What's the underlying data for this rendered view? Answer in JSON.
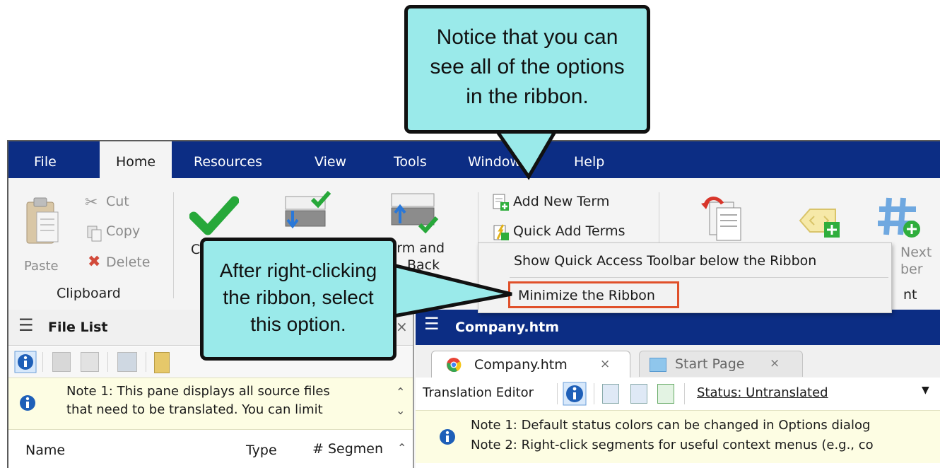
{
  "menu": {
    "tabs": [
      "File",
      "Home",
      "Resources",
      "View",
      "Tools",
      "Window",
      "Help"
    ],
    "active": "Home"
  },
  "ribbon": {
    "clipboard": {
      "paste": "Paste",
      "cut": "Cut",
      "copy": "Copy",
      "delete": "Delete",
      "group_label": "Clipboard"
    },
    "confirm_partial": "C",
    "confirm_back_line1": "irm and",
    "confirm_back_line2": "Back",
    "terms": {
      "add_new": "Add New Term",
      "quick_add": "Quick Add Terms"
    },
    "next_partial_1": "Next",
    "next_partial_2": "ber",
    "group_partial": "nt"
  },
  "context_menu": {
    "items": [
      "Show Quick Access Toolbar below the Ribbon",
      "Minimize the Ribbon"
    ],
    "highlight_color": "#e0502a"
  },
  "file_list": {
    "title": "File List",
    "note_line1": "Note 1: This pane displays all source files",
    "note_line2": "that need to be translated. You can limit",
    "columns": [
      "Name",
      "Type",
      "# Segmen"
    ]
  },
  "editor": {
    "title": "Company.htm",
    "tabs": [
      {
        "label": "Company.htm",
        "close": "×"
      },
      {
        "label": "Start Page",
        "close": "×"
      }
    ],
    "toolbar_label": "Translation Editor",
    "status": "Status: Untranslated",
    "note_line1": "Note 1: Default status colors can be changed in Options dialog",
    "note_line2": "Note 2: Right-click segments for useful context menus (e.g., co"
  },
  "callouts": {
    "top": [
      "Notice that you can",
      "see all of the options",
      "in the ribbon."
    ],
    "left": [
      "After right-clicking",
      "the ribbon, select",
      "this option."
    ]
  },
  "colors": {
    "menubar": "#0c2d84",
    "callout_fill": "#9aeaea",
    "info_blue": "#1e5fb8",
    "note_bg": "#fdfde3"
  },
  "pane_close": "×"
}
